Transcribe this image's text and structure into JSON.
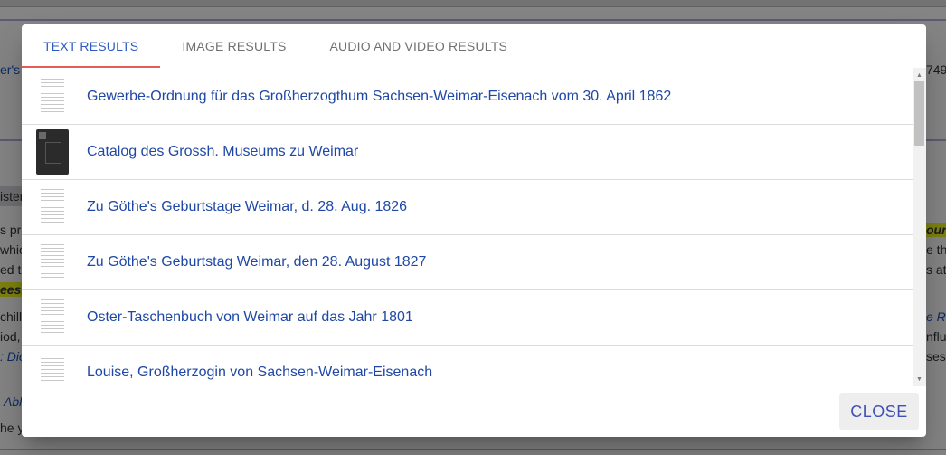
{
  "background": {
    "fragments": [
      {
        "text": "er's",
        "kind": "link"
      },
      {
        "text": "749",
        "kind": "plain"
      },
      {
        "text": "ister",
        "kind": "plain"
      },
      {
        "text": "s pr",
        "kind": "plain"
      },
      {
        "text": "ounc",
        "kind": "hl"
      },
      {
        "text": "whic",
        "kind": "plain"
      },
      {
        "text": "e th",
        "kind": "plain"
      },
      {
        "text": "ed th",
        "kind": "plain"
      },
      {
        "text": "s at",
        "kind": "plain"
      },
      {
        "text": "eesh",
        "kind": "hl"
      },
      {
        "text": "chille",
        "kind": "plain"
      },
      {
        "text": "e Ro",
        "kind": "italic-link"
      },
      {
        "text": "iod,",
        "kind": "plain"
      },
      {
        "text": "nflue",
        "kind": "plain"
      },
      {
        "text": ": Dic",
        "kind": "italic-link"
      },
      {
        "text": "ses",
        "kind": "plain"
      },
      {
        "text": "Abl",
        "kind": "italic-link"
      },
      {
        "text": "he y",
        "kind": "plain"
      }
    ]
  },
  "dialog": {
    "tabs": [
      {
        "label": "TEXT RESULTS",
        "active": true
      },
      {
        "label": "IMAGE RESULTS",
        "active": false
      },
      {
        "label": "AUDIO AND VIDEO RESULTS",
        "active": false
      }
    ],
    "results": [
      {
        "title": "Gewerbe-Ordnung für das Großherzogthum Sachsen-Weimar-Eisenach vom 30. April 1862",
        "thumb": "doc"
      },
      {
        "title": "Catalog des Grossh. Museums zu Weimar",
        "thumb": "dark"
      },
      {
        "title": "Zu Göthe's Geburtstage Weimar, d. 28. Aug. 1826",
        "thumb": "doc"
      },
      {
        "title": "Zu Göthe's Geburtstag Weimar, den 28. August 1827",
        "thumb": "doc"
      },
      {
        "title": "Oster-Taschenbuch von Weimar auf das Jahr 1801",
        "thumb": "doc"
      },
      {
        "title": "Louise, Großherzogin von Sachsen-Weimar-Eisenach",
        "thumb": "doc"
      }
    ],
    "close_label": "CLOSE"
  },
  "colors": {
    "accent": "#2c59c2",
    "tab_indicator": "#e35b5b",
    "link": "#1f48a6",
    "highlight": "#e8ec1e"
  }
}
